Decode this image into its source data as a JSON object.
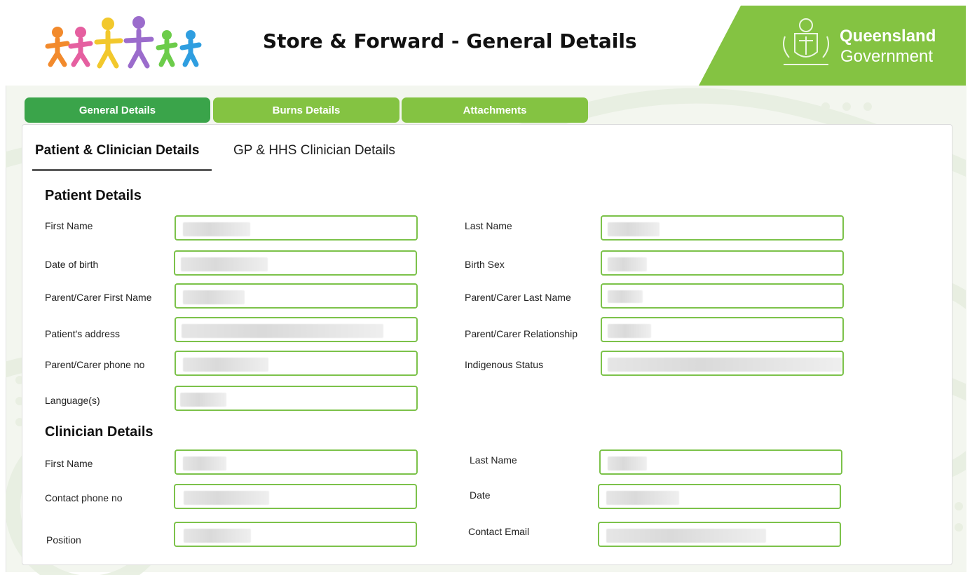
{
  "header": {
    "title": "Store & Forward - General Details",
    "brand_line1": "Queensland",
    "brand_line2": "Government",
    "accent_green": "#84c342",
    "active_tab_green": "#3aa44a"
  },
  "tabs": [
    {
      "label": "General Details",
      "active": true
    },
    {
      "label": "Burns Details",
      "active": false
    },
    {
      "label": "Attachments",
      "active": false
    }
  ],
  "subtabs": [
    {
      "label": "Patient & Clinician Details",
      "active": true
    },
    {
      "label": "GP & HHS Clinician Details",
      "active": false
    }
  ],
  "patient": {
    "title": "Patient Details",
    "labels": {
      "first_name": "First Name",
      "last_name": "Last Name",
      "dob": "Date of birth",
      "birth_sex": "Birth Sex",
      "carer_first": "Parent/Carer First Name",
      "carer_last": "Parent/Carer  Last Name",
      "address": "Patient's address",
      "carer_relationship": "Parent/Carer Relationship",
      "carer_phone": "Parent/Carer phone no",
      "indigenous": "Indigenous Status",
      "languages": "Language(s)"
    }
  },
  "clinician": {
    "title": "Clinician Details",
    "labels": {
      "first_name": "First Name",
      "last_name": "Last Name",
      "phone": "Contact phone no",
      "date": "Date",
      "position": "Position",
      "email": "Contact Email"
    }
  }
}
